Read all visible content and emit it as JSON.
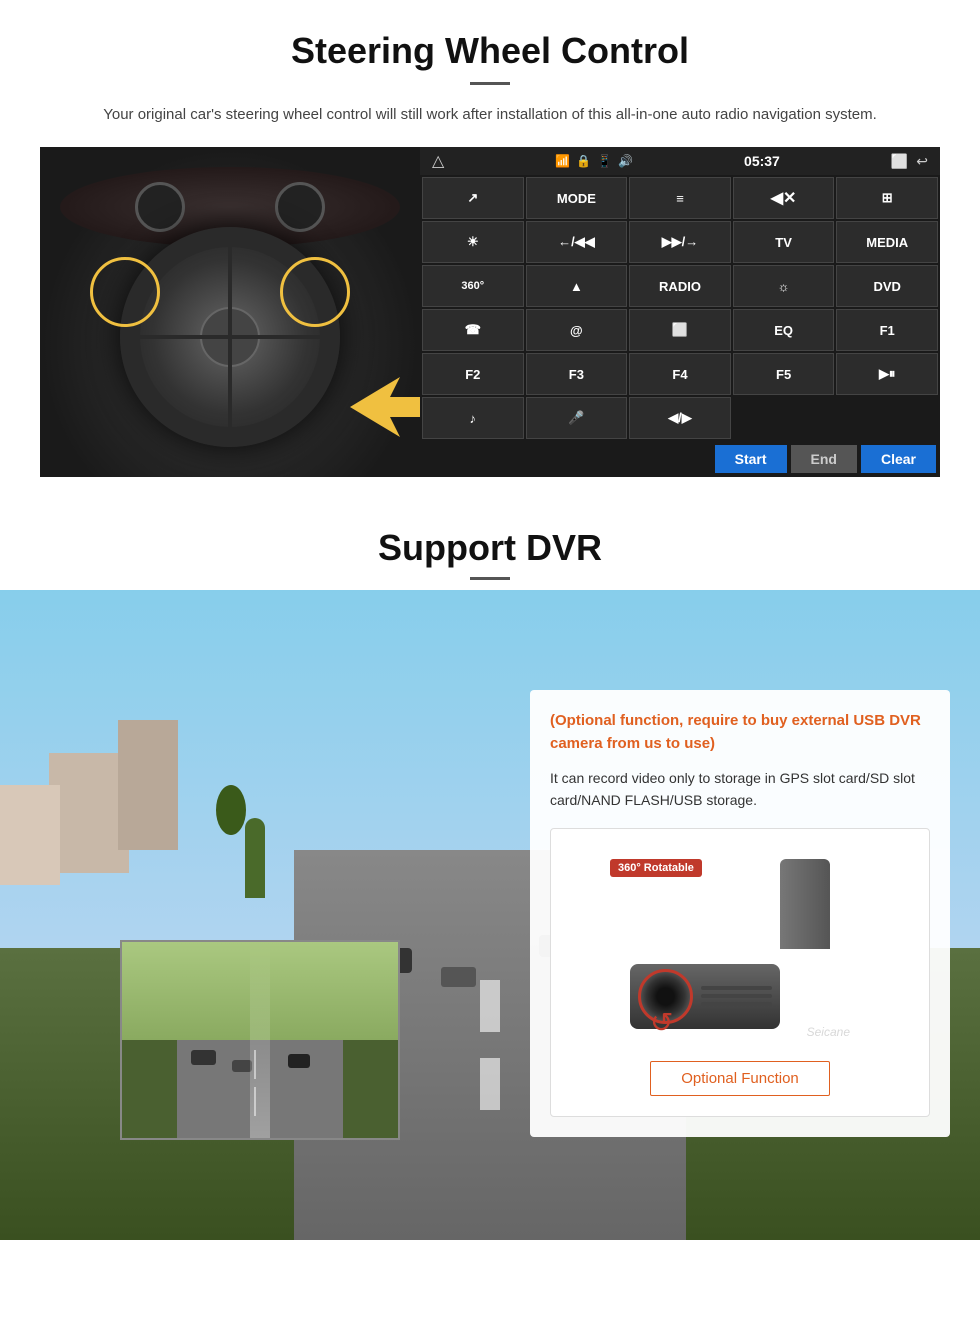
{
  "steering": {
    "title": "Steering Wheel Control",
    "description": "Your original car's steering wheel control will still work after installation of this all-in-one auto radio navigation system.",
    "panel": {
      "time": "05:37",
      "buttons": [
        {
          "label": "↗",
          "row": 1
        },
        {
          "label": "MODE",
          "row": 1
        },
        {
          "label": "≡",
          "row": 1
        },
        {
          "label": "◀✕",
          "row": 1
        },
        {
          "label": "⊞",
          "row": 1
        },
        {
          "label": "☀",
          "row": 2
        },
        {
          "label": "←/◀◀",
          "row": 2
        },
        {
          "label": "▶▶/→",
          "row": 2
        },
        {
          "label": "TV",
          "row": 2
        },
        {
          "label": "MEDIA",
          "row": 2
        },
        {
          "label": "360°",
          "row": 3
        },
        {
          "label": "▲",
          "row": 3
        },
        {
          "label": "RADIO",
          "row": 3
        },
        {
          "label": "☼",
          "row": 3
        },
        {
          "label": "DVD",
          "row": 3
        },
        {
          "label": "☎",
          "row": 4
        },
        {
          "label": "@",
          "row": 4
        },
        {
          "label": "⬜",
          "row": 4
        },
        {
          "label": "EQ",
          "row": 4
        },
        {
          "label": "F1",
          "row": 4
        },
        {
          "label": "F2",
          "row": 5
        },
        {
          "label": "F3",
          "row": 5
        },
        {
          "label": "F4",
          "row": 5
        },
        {
          "label": "F5",
          "row": 5
        },
        {
          "label": "▶⏸",
          "row": 5
        },
        {
          "label": "♪",
          "row": 6
        },
        {
          "label": "🎤",
          "row": 6
        },
        {
          "label": "◀/▶",
          "row": 6
        }
      ],
      "start_btn": "Start",
      "end_btn": "End",
      "clear_btn": "Clear"
    }
  },
  "dvr": {
    "title": "Support DVR",
    "optional_text": "(Optional function, require to buy external USB DVR camera from us to use)",
    "description": "It can record video only to storage in GPS slot card/SD slot card/NAND FLASH/USB storage.",
    "camera_badge": "360° Rotatable",
    "watermark": "Seicane",
    "optional_function_label": "Optional Function"
  }
}
